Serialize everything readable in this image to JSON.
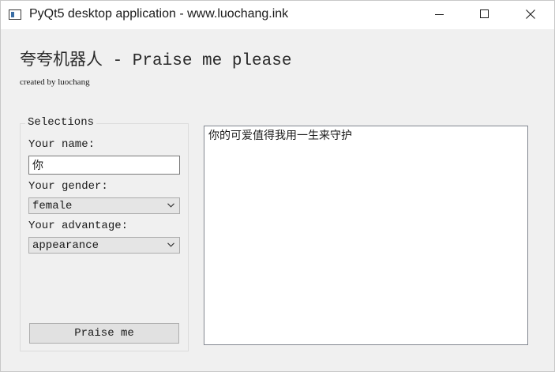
{
  "window": {
    "title": "PyQt5 desktop application - www.luochang.ink",
    "icons": {
      "app": "app-window-icon",
      "minimize": "minimize-icon",
      "maximize": "maximize-icon",
      "close": "close-icon"
    }
  },
  "header": {
    "title": "夸夸机器人 - Praise me please",
    "subtitle": "created by luochang"
  },
  "selections": {
    "group_title": "Selections",
    "name_label": "Your name:",
    "name_value": "你",
    "gender_label": "Your gender:",
    "gender_value": "female",
    "advantage_label": "Your advantage:",
    "advantage_value": "appearance",
    "praise_button": "Praise me"
  },
  "output": {
    "text": "你的可爱值得我用一生来守护"
  }
}
